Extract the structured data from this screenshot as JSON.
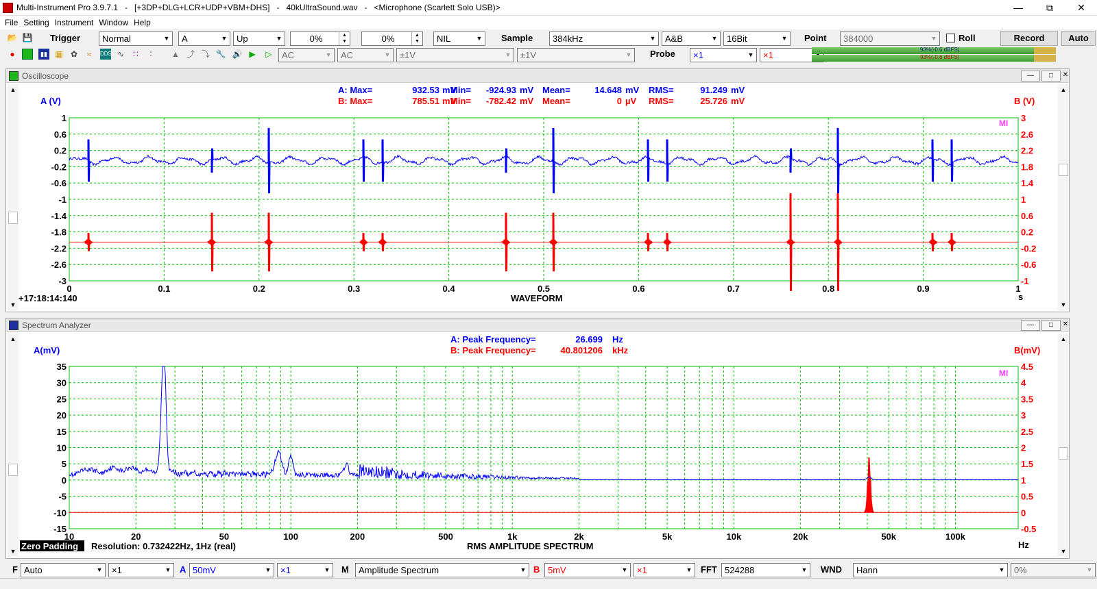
{
  "window": {
    "title": "Multi-Instrument Pro 3.9.7.1   -   [+3DP+DLG+LCR+UDP+VBM+DHS]   -   40kUltraSound.wav   -   <Microphone (Scarlett Solo USB)>"
  },
  "menu": [
    "File",
    "Setting",
    "Instrument",
    "Window",
    "Help"
  ],
  "toolbar1": {
    "trigger_label": "Trigger",
    "trigger_mode": "Normal",
    "trigger_channel": "A",
    "trigger_edge": "Up",
    "trigger_level": "0%",
    "trigger_delay": "0%",
    "trigger_nil": "NIL",
    "sample_label": "Sample",
    "sample_rate": "384kHz",
    "channels": "A&B",
    "bits": "16Bit",
    "point_label": "Point",
    "points": "384000",
    "roll_label": "Roll",
    "record_label": "Record",
    "auto_label": "Auto"
  },
  "toolbar2": {
    "couple_a": "AC",
    "couple_b": "AC",
    "range_a": "±1V",
    "range_b": "±1V",
    "probe_label": "Probe",
    "probe_a": "×1",
    "probe_b": "×1",
    "level_a": "93%(-0.6 dBFS)",
    "level_b": "93%(-0.6 dBFS)"
  },
  "oscilloscope": {
    "title": "Oscilloscope",
    "stats_a": {
      "label_max": "A: Max=",
      "max": "932.53",
      "u_max": "mV",
      "label_min": "Min=",
      "min": "-924.93",
      "u_min": "mV",
      "label_mean": "Mean=",
      "mean": "14.648",
      "u_mean": "mV",
      "label_rms": "RMS=",
      "rms": "91.249",
      "u_rms": "mV"
    },
    "stats_b": {
      "label_max": "B: Max=",
      "max": "785.51",
      "u_max": "mV",
      "label_min": "Min=",
      "min": "-782.42",
      "u_min": "mV",
      "label_mean": "Mean=",
      "mean": "0",
      "u_mean": "µV",
      "label_rms": "RMS=",
      "rms": "25.726",
      "u_rms": "mV"
    },
    "ylabel_a": "A (V)",
    "ylabel_b": "B (V)",
    "mi": "MI",
    "time_offset": "+17:18:14:140",
    "xlabel": "WAVEFORM",
    "xunit": "s",
    "yticks_a": [
      "1",
      "0.6",
      "0.2",
      "-0.2",
      "-0.6",
      "-1",
      "-1.4",
      "-1.8",
      "-2.2",
      "-2.6",
      "-3"
    ],
    "yticks_b": [
      "3",
      "2.6",
      "2.2",
      "1.8",
      "1.4",
      "1",
      "0.6",
      "0.2",
      "-0.2",
      "-0.6",
      "-1"
    ],
    "xticks": [
      "0",
      "0.1",
      "0.2",
      "0.3",
      "0.4",
      "0.5",
      "0.6",
      "0.7",
      "0.8",
      "0.9",
      "1"
    ],
    "colors": {
      "a": "#0000ff",
      "b": "#ff0000",
      "grid": "#00c000"
    }
  },
  "chart_data": [
    {
      "type": "line",
      "xlabel": "WAVEFORM",
      "ylabel": "A (V)",
      "y2label": "B (V)",
      "xlim": [
        0,
        1
      ],
      "ylim": [
        -3,
        1
      ],
      "y2lim": [
        -1,
        3
      ],
      "series": [
        {
          "name": "A",
          "values_note": "",
          "baseline": -0.05
        },
        {
          "name": "B",
          "baseline": -0.05
        }
      ],
      "burst_times": [
        0.02,
        0.15,
        0.21,
        0.31,
        0.33,
        0.46,
        0.51,
        0.61,
        0.63,
        0.76,
        0.81,
        0.91,
        0.93
      ]
    },
    {
      "type": "line",
      "xlabel": "RMS AMPLITUDE SPECTRUM",
      "ylabel": "A(mV)",
      "y2label": "B(mV)",
      "xscale": "log",
      "xlim": [
        10,
        192000
      ],
      "ylim": [
        -15,
        35
      ],
      "y2lim": [
        -0.5,
        4.5
      ],
      "peak_a_hz": 26.699,
      "peak_b_hz": 40801.206
    }
  ],
  "spectrum": {
    "title": "Spectrum Analyzer",
    "peak_a_label": "A: Peak Frequency=",
    "peak_a_value": "26.699",
    "peak_a_unit": "Hz",
    "peak_b_label": "B: Peak Frequency=",
    "peak_b_value": "40.801206",
    "peak_b_unit": "kHz",
    "ylabel_a": "A(mV)",
    "ylabel_b": "B(mV)",
    "mi": "MI",
    "yticks_a": [
      "35",
      "30",
      "25",
      "20",
      "15",
      "10",
      "5",
      "0",
      "-5",
      "-10",
      "-15"
    ],
    "yticks_b": [
      "4.5",
      "4",
      "3.5",
      "3",
      "2.5",
      "2",
      "1.5",
      "1",
      "0.5",
      "0",
      "-0.5"
    ],
    "xticks": [
      {
        "v": 10,
        "t": "10"
      },
      {
        "v": 20,
        "t": "20"
      },
      {
        "v": 50,
        "t": "50"
      },
      {
        "v": 100,
        "t": "100"
      },
      {
        "v": 200,
        "t": "200"
      },
      {
        "v": 500,
        "t": "500"
      },
      {
        "v": 1000,
        "t": "1k"
      },
      {
        "v": 2000,
        "t": "2k"
      },
      {
        "v": 5000,
        "t": "5k"
      },
      {
        "v": 10000,
        "t": "10k"
      },
      {
        "v": 20000,
        "t": "20k"
      },
      {
        "v": 50000,
        "t": "50k"
      },
      {
        "v": 100000,
        "t": "100k"
      }
    ],
    "zero_padding": "Zero Padding",
    "resolution": "Resolution: 0.732422Hz, 1Hz (real)",
    "xlabel": "RMS AMPLITUDE SPECTRUM",
    "xunit": "Hz"
  },
  "bottombar": {
    "f_label": "F",
    "f_mode": "Auto",
    "f_mult": "×1",
    "a_label": "A",
    "a_scale": "50mV",
    "a_mult": "×1",
    "m_label": "M",
    "m_mode": "Amplitude Spectrum",
    "b_label": "B",
    "b_scale": "5mV",
    "b_mult": "×1",
    "fft_label": "FFT",
    "fft_size": "524288",
    "wnd_label": "WND",
    "wnd": "Hann",
    "overlap": "0%"
  }
}
